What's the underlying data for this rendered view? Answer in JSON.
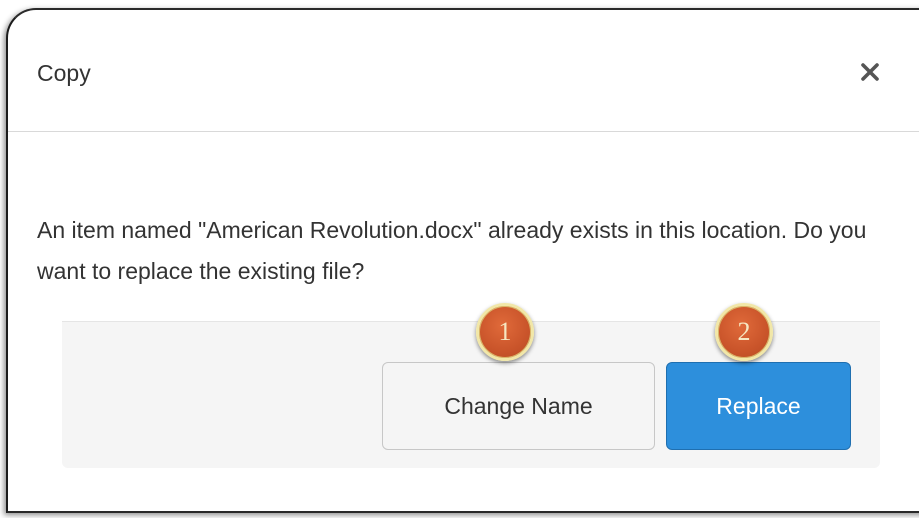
{
  "dialog": {
    "title": "Copy",
    "close_icon": "close-icon",
    "message": "An item named \"American Revolution.docx\" already exists in this location. Do you want to replace the existing file?",
    "buttons": {
      "change_name": "Change Name",
      "replace": "Replace"
    }
  },
  "callouts": {
    "first": "1",
    "second": "2"
  },
  "colors": {
    "primary_button": "#2d8fdc",
    "callout_fill": "#c9542a",
    "callout_ring": "#f1e7a8",
    "text": "#333333"
  }
}
